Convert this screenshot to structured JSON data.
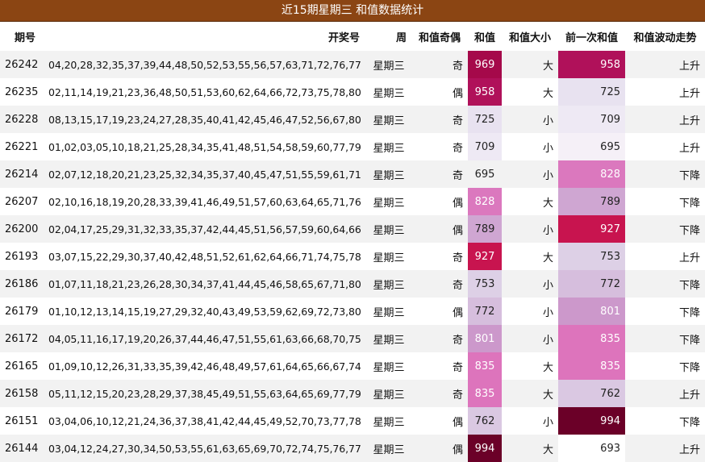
{
  "title": "近15期星期三 和值数据统计",
  "headers": {
    "issue": "期号",
    "numbers": "开奖号",
    "week": "周",
    "parity": "和值奇偶",
    "sum": "和值",
    "size": "和值大小",
    "prev": "前一次和值",
    "trend": "和值波动走势"
  },
  "colors": {
    "title_bg": "#8b4513",
    "row_stripe": "#f2f2f2",
    "heat_low": "#f5f0f7",
    "heat_high": "#6b0028"
  },
  "rows": [
    {
      "issue": "26242",
      "numbers": "04,20,28,32,35,37,39,44,48,50,52,53,55,56,57,63,71,72,76,77",
      "week": "星期三",
      "parity": "奇",
      "sum": "969",
      "size": "大",
      "prev": "958",
      "trend": "上升",
      "sum_bg": "#a5094a",
      "sum_fg": "#ffffff",
      "prev_bg": "#b0115a",
      "prev_fg": "#ffffff"
    },
    {
      "issue": "26235",
      "numbers": "02,11,14,19,21,23,36,48,50,51,53,60,62,64,66,72,73,75,78,80",
      "week": "星期三",
      "parity": "偶",
      "sum": "958",
      "size": "大",
      "prev": "725",
      "trend": "上升",
      "sum_bg": "#b0115a",
      "sum_fg": "#ffffff",
      "prev_bg": "#e8e2f0",
      "prev_fg": "#222222"
    },
    {
      "issue": "26228",
      "numbers": "08,13,15,17,19,23,24,27,28,35,40,41,42,45,46,47,52,56,67,80",
      "week": "星期三",
      "parity": "奇",
      "sum": "725",
      "size": "小",
      "prev": "709",
      "trend": "上升",
      "sum_bg": "#e8e2f0",
      "sum_fg": "#222222",
      "prev_bg": "#eee9f4",
      "prev_fg": "#222222"
    },
    {
      "issue": "26221",
      "numbers": "01,02,03,05,10,18,21,25,28,34,35,41,48,51,54,58,59,60,77,79",
      "week": "星期三",
      "parity": "奇",
      "sum": "709",
      "size": "小",
      "prev": "695",
      "trend": "上升",
      "sum_bg": "#eee9f4",
      "sum_fg": "#222222",
      "prev_bg": "#f5f0f7",
      "prev_fg": "#222222"
    },
    {
      "issue": "26214",
      "numbers": "02,07,12,18,20,21,23,25,32,34,35,37,40,45,47,51,55,59,61,71",
      "week": "星期三",
      "parity": "奇",
      "sum": "695",
      "size": "小",
      "prev": "828",
      "trend": "下降",
      "sum_bg": "#f2f2f2",
      "sum_fg": "#222222",
      "prev_bg": "#db78be",
      "prev_fg": "#ffffff"
    },
    {
      "issue": "26207",
      "numbers": "02,10,16,18,19,20,28,33,39,41,46,49,51,57,60,63,64,65,71,76",
      "week": "星期三",
      "parity": "偶",
      "sum": "828",
      "size": "大",
      "prev": "789",
      "trend": "下降",
      "sum_bg": "#db78be",
      "sum_fg": "#ffffff",
      "prev_bg": "#cfa6d2",
      "prev_fg": "#222222"
    },
    {
      "issue": "26200",
      "numbers": "02,04,17,25,29,31,32,33,35,37,42,44,45,51,56,57,59,60,64,66",
      "week": "星期三",
      "parity": "偶",
      "sum": "789",
      "size": "小",
      "prev": "927",
      "trend": "下降",
      "sum_bg": "#cfa6d2",
      "sum_fg": "#222222",
      "prev_bg": "#c8144f",
      "prev_fg": "#ffffff"
    },
    {
      "issue": "26193",
      "numbers": "03,07,15,22,29,30,37,40,42,48,51,52,61,62,64,66,71,74,75,78",
      "week": "星期三",
      "parity": "奇",
      "sum": "927",
      "size": "大",
      "prev": "753",
      "trend": "上升",
      "sum_bg": "#c8144f",
      "sum_fg": "#ffffff",
      "prev_bg": "#ddd0e6",
      "prev_fg": "#222222"
    },
    {
      "issue": "26186",
      "numbers": "01,07,11,18,21,23,26,28,30,34,37,41,44,45,46,58,65,67,71,80",
      "week": "星期三",
      "parity": "奇",
      "sum": "753",
      "size": "小",
      "prev": "772",
      "trend": "下降",
      "sum_bg": "#ddd0e6",
      "sum_fg": "#222222",
      "prev_bg": "#d6bedd",
      "prev_fg": "#222222"
    },
    {
      "issue": "26179",
      "numbers": "01,10,12,13,14,15,19,27,29,32,40,43,49,53,59,62,69,72,73,80",
      "week": "星期三",
      "parity": "偶",
      "sum": "772",
      "size": "小",
      "prev": "801",
      "trend": "下降",
      "sum_bg": "#d6bedd",
      "sum_fg": "#222222",
      "prev_bg": "#cc98cb",
      "prev_fg": "#ffffff"
    },
    {
      "issue": "26172",
      "numbers": "04,05,11,16,17,19,20,26,37,44,46,47,51,55,61,63,66,68,70,75",
      "week": "星期三",
      "parity": "奇",
      "sum": "801",
      "size": "小",
      "prev": "835",
      "trend": "下降",
      "sum_bg": "#cc98cb",
      "sum_fg": "#ffffff",
      "prev_bg": "#dd74bc",
      "prev_fg": "#ffffff"
    },
    {
      "issue": "26165",
      "numbers": "01,09,10,12,26,31,33,35,39,42,46,48,49,57,61,64,65,66,67,74",
      "week": "星期三",
      "parity": "奇",
      "sum": "835",
      "size": "大",
      "prev": "835",
      "trend": "下降",
      "sum_bg": "#dd74bc",
      "sum_fg": "#ffffff",
      "prev_bg": "#dd74bc",
      "prev_fg": "#ffffff"
    },
    {
      "issue": "26158",
      "numbers": "05,11,12,15,20,23,28,29,37,38,45,49,51,55,63,64,65,69,77,79",
      "week": "星期三",
      "parity": "奇",
      "sum": "835",
      "size": "大",
      "prev": "762",
      "trend": "上升",
      "sum_bg": "#dd74bc",
      "sum_fg": "#ffffff",
      "prev_bg": "#dac8e2",
      "prev_fg": "#222222"
    },
    {
      "issue": "26151",
      "numbers": "03,04,06,10,12,21,24,36,37,38,41,42,44,45,49,52,70,73,77,78",
      "week": "星期三",
      "parity": "偶",
      "sum": "762",
      "size": "小",
      "prev": "994",
      "trend": "下降",
      "sum_bg": "#dac8e2",
      "sum_fg": "#222222",
      "prev_bg": "#6b0028",
      "prev_fg": "#ffffff"
    },
    {
      "issue": "26144",
      "numbers": "03,04,12,24,27,30,34,50,53,55,61,63,65,69,70,72,74,75,76,77",
      "week": "星期三",
      "parity": "偶",
      "sum": "994",
      "size": "大",
      "prev": "693",
      "trend": "上升",
      "sum_bg": "#6b0028",
      "sum_fg": "#ffffff",
      "prev_bg": "#ffffff",
      "prev_fg": "#222222"
    }
  ]
}
